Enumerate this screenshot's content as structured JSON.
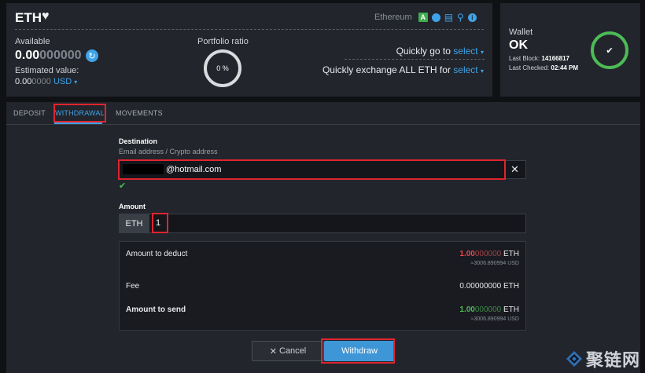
{
  "header": {
    "title": "ETH",
    "network": "Ethereum",
    "network_badge": "A",
    "available_label": "Available",
    "available_bold": "0.00",
    "available_dim": "000000",
    "estimated_label": "Estimated value:",
    "estimated_bold": "0.00",
    "estimated_dim": "0000",
    "estimated_currency": "USD",
    "portfolio_label": "Portfolio ratio",
    "portfolio_value": "0 %",
    "quick_goto_text": "Quickly go to",
    "quick_goto_link": "select",
    "quick_exchange_text": "Quickly exchange ALL ETH for",
    "quick_exchange_link": "select"
  },
  "wallet": {
    "label": "Wallet",
    "status": "OK",
    "last_block_label": "Last Block:",
    "last_block_value": "14166817",
    "last_checked_label": "Last Checked:",
    "last_checked_value": "02:44 PM"
  },
  "tabs": [
    {
      "label": "DEPOSIT"
    },
    {
      "label": "WITHDRAWAL",
      "active": true
    },
    {
      "label": "MOVEMENTS"
    }
  ],
  "form": {
    "destination_title": "Destination",
    "destination_sub": "Email address / Crypto address",
    "destination_value": "@hotmail.com",
    "amount_title": "Amount",
    "amount_unit": "ETH",
    "amount_value": "1"
  },
  "summary": {
    "deduct_label": "Amount to deduct",
    "deduct_bold": "1.00",
    "deduct_dim": "000000",
    "deduct_unit": "ETH",
    "deduct_usd": "≈3006.890994 USD",
    "fee_label": "Fee",
    "fee_value": "0.00000000 ETH",
    "send_label": "Amount to send",
    "send_bold": "1.00",
    "send_dim": "000000",
    "send_unit": "ETH",
    "send_usd": "≈3006.890994 USD"
  },
  "buttons": {
    "cancel": "Cancel",
    "withdraw": "Withdraw"
  },
  "watermark": "聚链网",
  "colors": {
    "accent": "#3fa3e8",
    "success": "#4cbb55",
    "danger": "#e84550",
    "highlight_box": "#e0242e"
  }
}
